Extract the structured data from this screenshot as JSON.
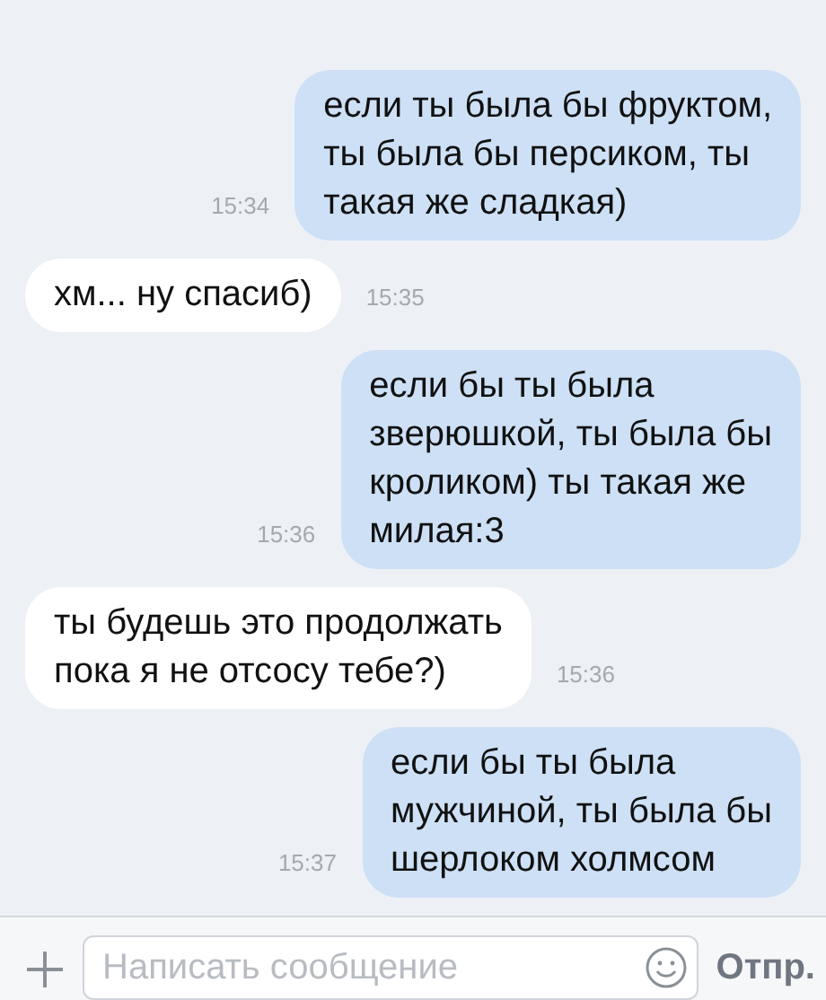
{
  "messages": [
    {
      "kind": "outgoing",
      "text": "если ты была бы фруктом,\nты была бы персиком, ты\nтакая же сладкая)",
      "time": "15:34"
    },
    {
      "kind": "incoming",
      "text": "хм... ну спасиб)",
      "time": "15:35"
    },
    {
      "kind": "outgoing",
      "text": "если бы ты была\nзверюшкой, ты была бы\nкроликом) ты такая же\nмилая:3",
      "time": "15:36"
    },
    {
      "kind": "incoming",
      "text": "ты будешь это продолжать\nпока я не отсосу тебе?)",
      "time": "15:36"
    },
    {
      "kind": "outgoing",
      "text": "если бы ты была\nмужчиной, ты была бы\nшерлоком холмсом",
      "time": "15:37"
    }
  ],
  "composer": {
    "placeholder": "Написать сообщение",
    "send": "Отпр."
  }
}
